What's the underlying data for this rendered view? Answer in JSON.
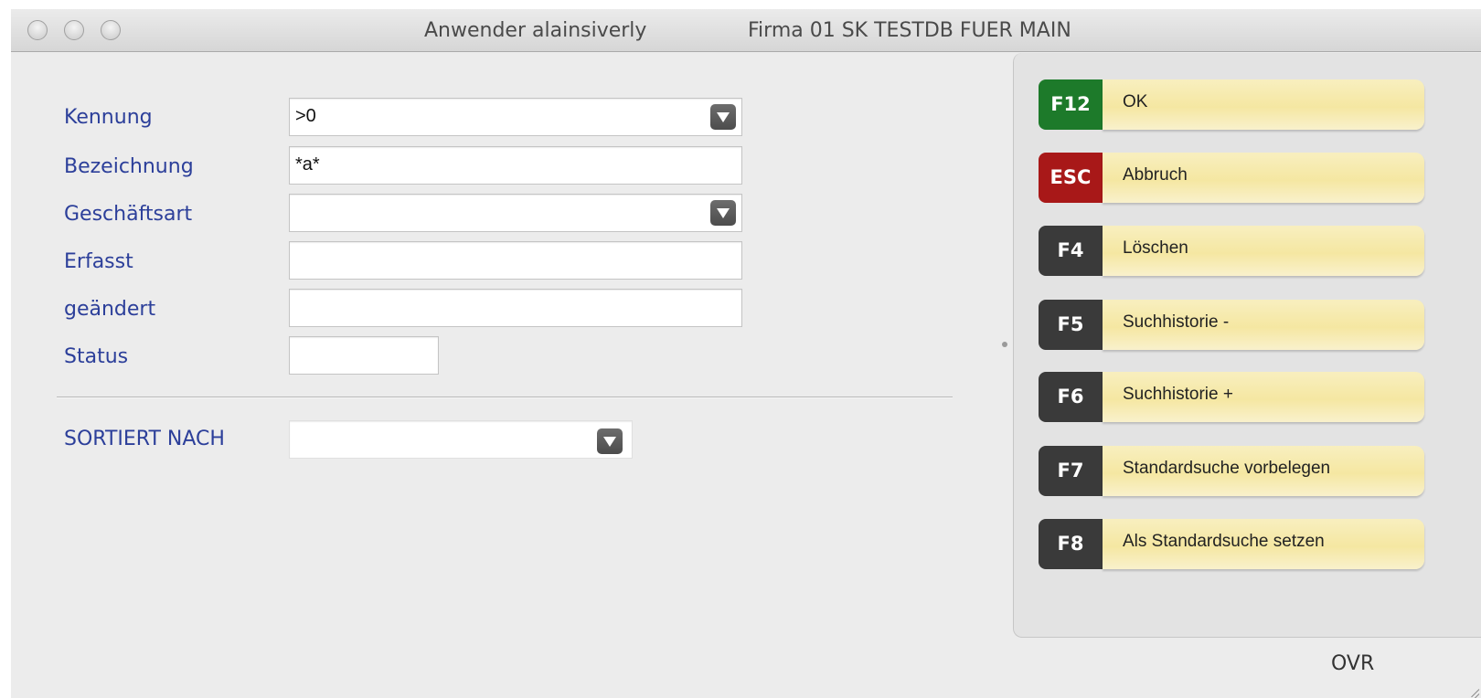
{
  "window": {
    "user_title": "Anwender alainsiverly",
    "company_title": "Firma 01 SK TESTDB FUER MAIN"
  },
  "form": {
    "kennung": {
      "label": "Kennung",
      "value": ">0"
    },
    "bezeichnung": {
      "label": "Bezeichnung",
      "value": "*a*"
    },
    "geschaeftsart": {
      "label": "Geschäftsart",
      "value": ""
    },
    "erfasst": {
      "label": "Erfasst",
      "value": ""
    },
    "geaendert": {
      "label": "geändert",
      "value": ""
    },
    "status": {
      "label": "Status",
      "value": ""
    },
    "sortiert": {
      "label": "SORTIERT NACH",
      "value": ""
    }
  },
  "actions": [
    {
      "key": "F12",
      "label": "OK",
      "key_color": "#1d7a2a"
    },
    {
      "key": "ESC",
      "label": "Abbruch",
      "key_color": "#a81818"
    },
    {
      "key": "F4",
      "label": "Löschen",
      "key_color": "#3a3a3a"
    },
    {
      "key": "F5",
      "label": "Suchhistorie -",
      "key_color": "#3a3a3a"
    },
    {
      "key": "F6",
      "label": "Suchhistorie +",
      "key_color": "#3a3a3a"
    },
    {
      "key": "F7",
      "label": "Standardsuche vorbelegen",
      "key_color": "#3a3a3a"
    },
    {
      "key": "F8",
      "label": "Als Standardsuche setzen",
      "key_color": "#3a3a3a"
    }
  ],
  "status_bar": {
    "mode": "OVR"
  }
}
